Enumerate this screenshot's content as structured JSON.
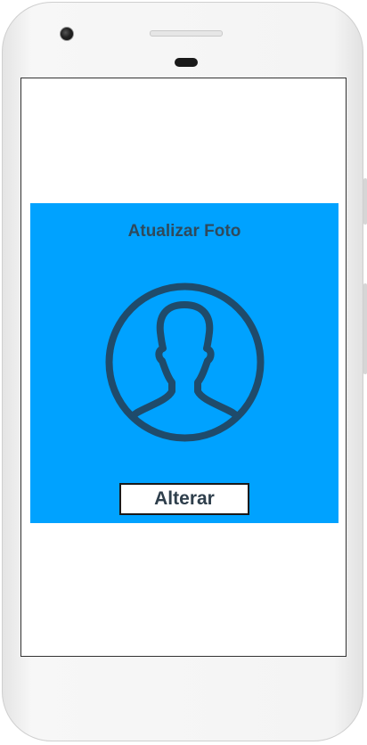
{
  "screen": {
    "panel": {
      "title": "Atualizar Foto",
      "avatar_icon": "user-avatar-icon",
      "change_button_label": "Alterar",
      "background_color": "#00a2ff",
      "icon_color": "#1f4b6b"
    }
  }
}
